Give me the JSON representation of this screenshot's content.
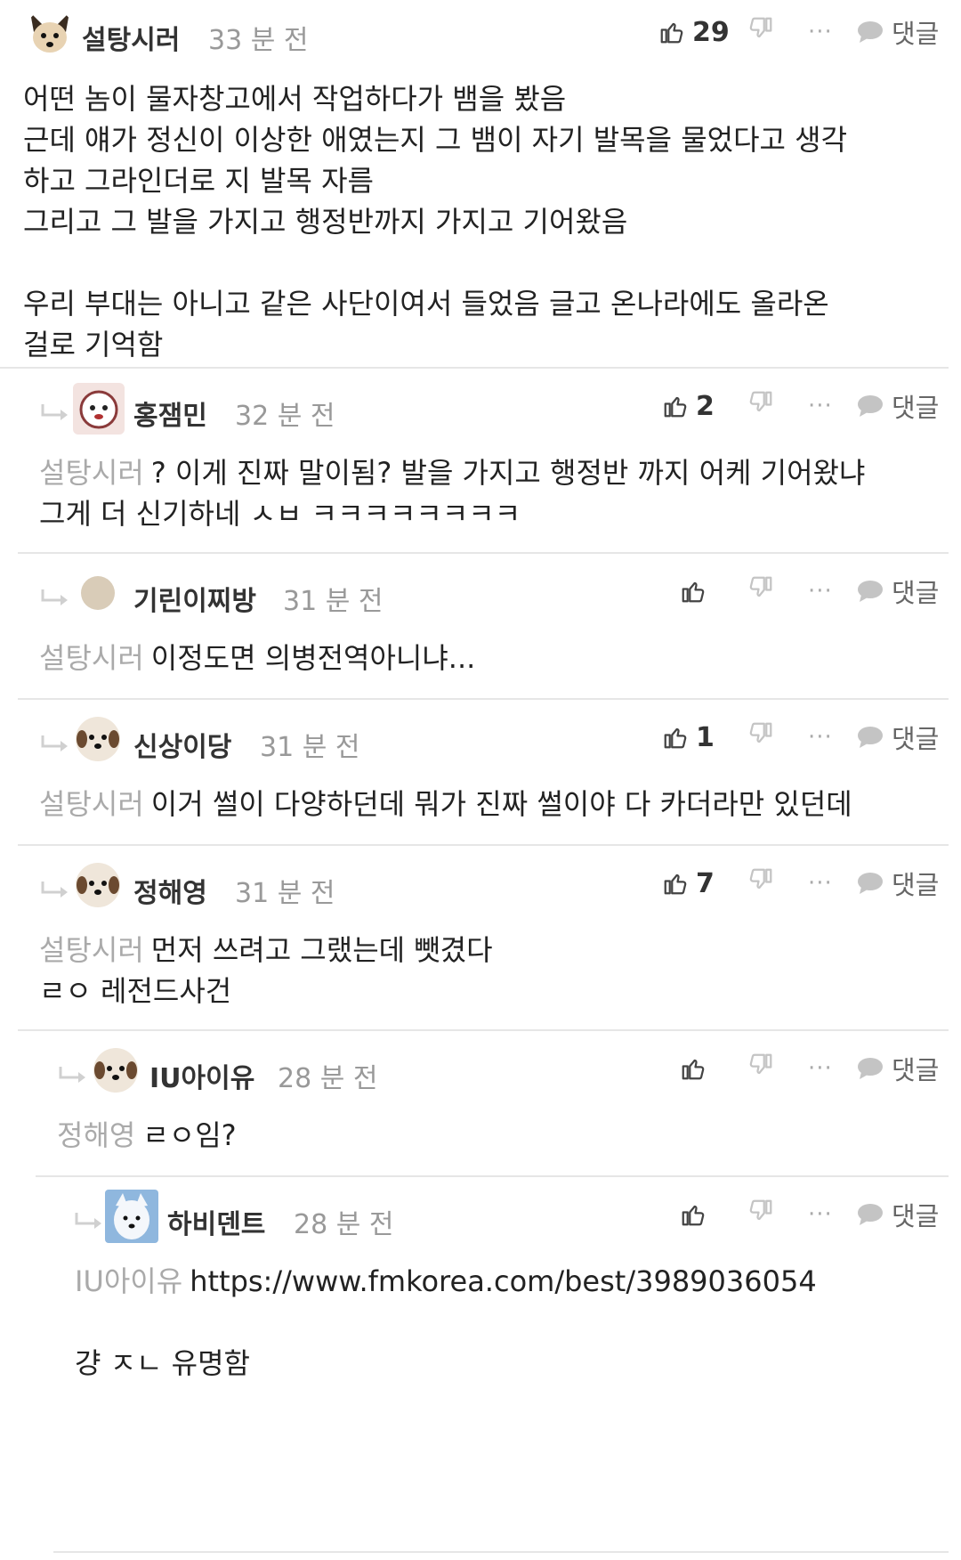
{
  "comments": [
    {
      "nickname": "설탕시러",
      "time": "33 분 전",
      "likes": "29",
      "reply_label": "댓글",
      "more_label": "···",
      "body_lines": [
        "어떤 놈이 물자창고에서 작업하다가 뱀을 봤음",
        "근데 얘가 정신이 이상한 애였는지 그 뱀이 자기 발목을 물었다고 생각",
        "하고 그라인더로 지 발목 자름",
        "그리고 그 발을 가지고 행정반까지 가지고 기어왔음",
        "",
        "우리 부대는 아니고 같은 사단이여서 들었음 글고 온나라에도 올라온",
        "걸로 기억함"
      ]
    },
    {
      "nickname": "홍잼민",
      "time": "32 분 전",
      "likes": "2",
      "reply_label": "댓글",
      "more_label": "···",
      "mention": "설탕시러",
      "body_lines": [
        "? 이게 진짜 말이됨? 발을 가지고 행정반 까지 어케 기어왔냐",
        "그게 더 신기하네 ㅅㅂ ㅋㅋㅋㅋㅋㅋㅋㅋ"
      ]
    },
    {
      "nickname": "기린이찌방",
      "time": "31 분 전",
      "likes": "",
      "reply_label": "댓글",
      "more_label": "···",
      "mention": "설탕시러",
      "body_lines": [
        "이정도면 의병전역아니냐..."
      ]
    },
    {
      "nickname": "신상이당",
      "time": "31 분 전",
      "likes": "1",
      "reply_label": "댓글",
      "more_label": "···",
      "mention": "설탕시러",
      "body_lines": [
        "이거 썰이 다양하던데 뭐가 진짜 썰이야 다 카더라만 있던데"
      ]
    },
    {
      "nickname": "정해영",
      "time": "31 분 전",
      "likes": "7",
      "reply_label": "댓글",
      "more_label": "···",
      "mention": "설탕시러",
      "body_lines": [
        "먼저 쓰려고 그랬는데 뺏겼다",
        "ㄹㅇ 레전드사건"
      ]
    },
    {
      "nickname": "IU아이유",
      "time": "28 분 전",
      "likes": "",
      "reply_label": "댓글",
      "more_label": "···",
      "mention": "정해영",
      "body_lines": [
        "ㄹㅇ임?"
      ]
    },
    {
      "nickname": "하비덴트",
      "time": "28 분 전",
      "likes": "",
      "reply_label": "댓글",
      "more_label": "···",
      "mention": "IU아이유",
      "body_lines": [
        "https://www.fmkorea.com/best/3989036054",
        "",
        "걍 ㅈㄴ 유명함"
      ]
    }
  ],
  "colors": {
    "text": "#222222",
    "muted": "#999999",
    "mention": "#aaaaaa",
    "divider": "#e6e6e6",
    "icon": "#444444",
    "icon_light": "#c4c4c4"
  }
}
